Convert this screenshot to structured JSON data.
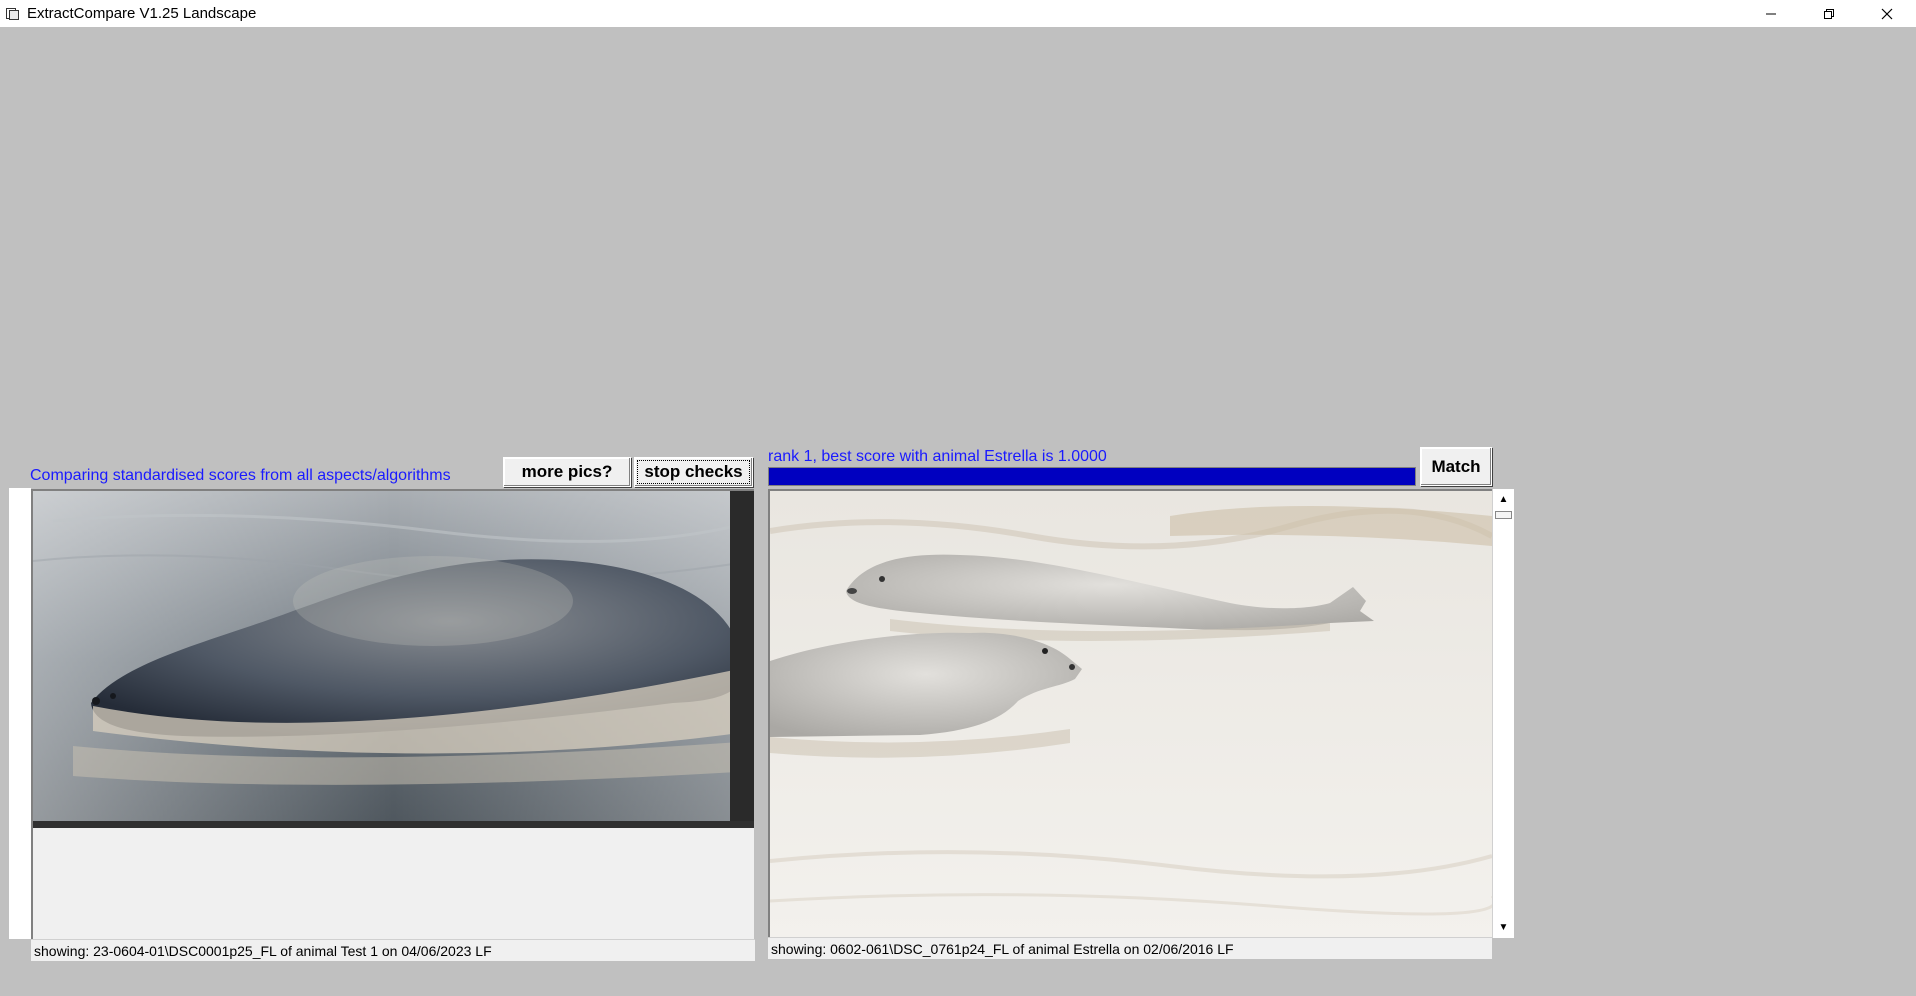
{
  "window": {
    "title": "ExtractCompare V1.25 Landscape",
    "icons": [
      "app-icon",
      "minimize-icon",
      "restore-icon",
      "close-icon"
    ]
  },
  "left": {
    "caption": "Comparing standardised scores from all aspects/algorithms",
    "more_pics_label": "more pics?",
    "stop_checks_label": "stop checks",
    "status": "showing: 23-0604-01\\DSC0001p25_FL of animal Test 1 on 04/06/2023 LF"
  },
  "right": {
    "rank_text": "rank 1, best score with animal Estrella is 1.0000",
    "match_label": "Match",
    "progress_fraction": 1.0,
    "status": "showing: 0602-061\\DSC_0761p24_FL of animal Estrella on 02/06/2016 LF",
    "scroll_up_icon": "▲",
    "scroll_down_icon": "▼"
  },
  "colors": {
    "background": "#c0c0c0",
    "caption_blue": "#1a1aff",
    "progress": "#0000c0"
  }
}
